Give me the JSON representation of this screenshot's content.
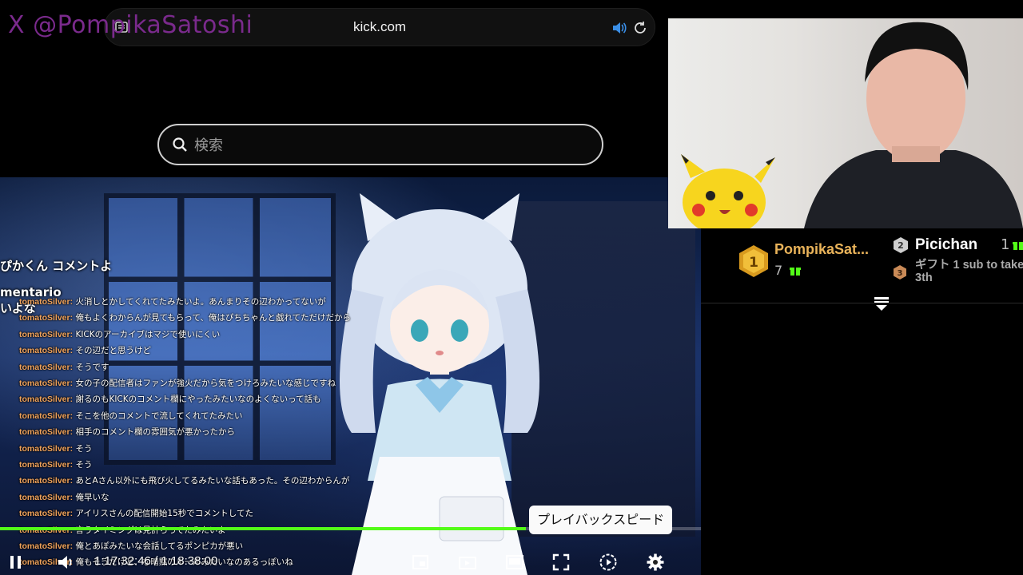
{
  "watermark": "X @PompikaSatoshi",
  "browser": {
    "url": "kick.com",
    "icons": [
      "tabs-icon",
      "speaker-icon",
      "reload-icon"
    ]
  },
  "search": {
    "placeholder": "検索",
    "value": ""
  },
  "video": {
    "overlay_lines": [
      "ぴかくん コメントよ",
      "mentario",
      "いよな"
    ],
    "chat": [
      {
        "user": "tomatoSilver:",
        "text": "火消しとかしてくれてたみたいよ。あんまりその辺わかってないが"
      },
      {
        "user": "tomatoSilver:",
        "text": "俺もよくわからんが見てもらって、俺はぴちちゃんと戯れてただけだから"
      },
      {
        "user": "tomatoSilver:",
        "text": "KICKのアーカイブはマジで使いにくい"
      },
      {
        "user": "tomatoSilver:",
        "text": "その辺だと思うけど"
      },
      {
        "user": "tomatoSilver:",
        "text": "そうです"
      },
      {
        "user": "tomatoSilver:",
        "text": "女の子の配信者はファンが強火だから気をつけろみたいな感じですね"
      },
      {
        "user": "tomatoSilver:",
        "text": "謝るのもKICKのコメント欄にやったみたいなのよくないって話も"
      },
      {
        "user": "tomatoSilver:",
        "text": "そこを他のコメントで流してくれてたみたい"
      },
      {
        "user": "tomatoSilver:",
        "text": "相手のコメント欄の雰囲気が悪かったから"
      },
      {
        "user": "tomatoSilver:",
        "text": "そう"
      },
      {
        "user": "tomatoSilver:",
        "text": "そう"
      },
      {
        "user": "tomatoSilver:",
        "text": "あとAさん以外にも飛び火してるみたいな話もあった。その辺わからんが"
      },
      {
        "user": "tomatoSilver:",
        "text": "俺早いな"
      },
      {
        "user": "tomatoSilver:",
        "text": "アイリスさんの配信開始15秒でコメントしてた"
      },
      {
        "user": "tomatoSilver:",
        "text": "言うタイミングは見計らってたみたいよ"
      },
      {
        "user": "tomatoSilver:",
        "text": "俺とあぽみたいな会話してるポンピカが悪い"
      },
      {
        "user": "tomatoSilver:",
        "text": "俺もそうだけど、な暗黙のルールみたいなのあるっぽいね"
      }
    ],
    "time": "1:17:32:46 / 1:18:38:00",
    "progress": 0.75,
    "tooltip": "プレイバックスピード",
    "controls": [
      "pause-icon",
      "volume-icon",
      "pip-icon",
      "theater-icon",
      "miniplayer-icon",
      "fullscreen-icon",
      "playback-speed-icon",
      "settings-icon"
    ]
  },
  "leaderboard": {
    "first": {
      "rank": "1",
      "name": "PompikaSat...",
      "count": "7"
    },
    "second": {
      "rank": "2",
      "name": "Picichan",
      "count": "1"
    },
    "third": {
      "rank": "3",
      "text": "ギフト 1 sub to take 3th"
    }
  },
  "colors": {
    "accent": "#53fc18",
    "gold": "#e9b35a",
    "username": "#f0a35c",
    "watermark": "#7a2a8c"
  }
}
